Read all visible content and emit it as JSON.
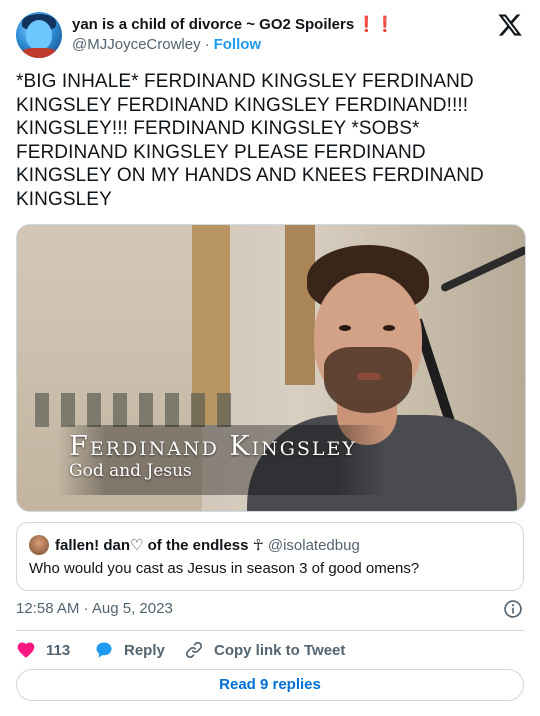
{
  "header": {
    "display_name": "yan is a child of divorce ~ GO2 Spoilers",
    "name_emoji": "❗❗",
    "handle": "@MJJoyceCrowley",
    "separator": "·",
    "follow_label": "Follow",
    "avatar_icon": "avatar-image",
    "logo_icon": "x-logo-icon"
  },
  "tweet": {
    "text": "*BIG INHALE* FERDINAND KINGSLEY FERDINAND KINGSLEY FERDINAND KINGSLEY FERDINAND!!!! KINGSLEY!!! FERDINAND KINGSLEY *SOBS* FERDINAND KINGSLEY PLEASE FERDINAND KINGSLEY ON MY HANDS AND KNEES FERDINAND KINGSLEY"
  },
  "media": {
    "caption_name": "Ferdinand Kingsley",
    "caption_subtitle": "God and Jesus"
  },
  "quote": {
    "display_name": "fallen! dan♡ of the endless ☥",
    "handle": "@isolatedbug",
    "text": "Who would you cast as Jesus in season 3 of good omens?"
  },
  "meta": {
    "timestamp": "12:58 AM · Aug 5, 2023"
  },
  "actions": {
    "like_count": "113",
    "reply_label": "Reply",
    "copy_label": "Copy link to Tweet"
  },
  "footer": {
    "read_replies_label": "Read 9 replies"
  },
  "colors": {
    "accent": "#1d9bf0",
    "like": "#f91880",
    "muted": "#536471",
    "border": "#cfd9de"
  }
}
